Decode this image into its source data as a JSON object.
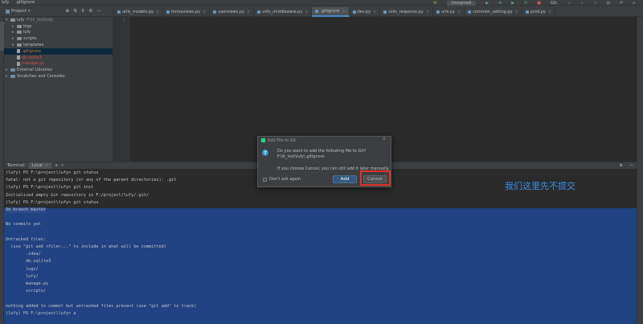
{
  "titlebar": {
    "project": "lufy",
    "file": ".gitignore",
    "run_config": "Unnamed",
    "git_label": "Git:"
  },
  "project_panel": {
    "title": "Project",
    "tree": [
      {
        "label": "lufy",
        "extra": "F:\\lk_test\\lufy",
        "depth": 0,
        "kind": "folder",
        "open": true
      },
      {
        "label": "logs",
        "depth": 1,
        "kind": "folder"
      },
      {
        "label": "lufy",
        "depth": 1,
        "kind": "folder"
      },
      {
        "label": "scripts",
        "depth": 1,
        "kind": "folder"
      },
      {
        "label": "templates",
        "depth": 1,
        "kind": "folder"
      },
      {
        "label": ".gitignore",
        "depth": 1,
        "kind": "file",
        "color": "#c77c2c",
        "selected": true
      },
      {
        "label": "db.sqlite3",
        "depth": 1,
        "kind": "file",
        "color": "#c75450"
      },
      {
        "label": "manage.py",
        "depth": 1,
        "kind": "file",
        "color": "#c75450"
      },
      {
        "label": "External Libraries",
        "depth": 0,
        "kind": "lib"
      },
      {
        "label": "Scratches and Consoles",
        "depth": 0,
        "kind": "lib"
      }
    ]
  },
  "tabs": [
    {
      "label": "utils_models.py"
    },
    {
      "label": "homeviews.py"
    },
    {
      "label": "userviews.py"
    },
    {
      "label": "utils_middleware.py"
    },
    {
      "label": ".gitignore",
      "active": true
    },
    {
      "label": "dev.py"
    },
    {
      "label": "utils_response.py"
    },
    {
      "label": "urls.py"
    },
    {
      "label": "common_setting.py"
    },
    {
      "label": "prod.py"
    }
  ],
  "editor": {
    "line_number": "1"
  },
  "terminal": {
    "tabs": [
      {
        "label": "Terminal:"
      },
      {
        "label": "Local"
      }
    ],
    "lines": [
      "(lufy) PS F:\\project\\lufy> git status",
      "fatal: not a git repository (or any of the parent directories): .git",
      "(lufy) PS F:\\project\\lufy> git init",
      "Initialized empty Git repository in F:/project/lufy/.git/",
      "(lufy) PS F:\\project\\lufy> git status",
      "On branch master",
      "",
      "No commits yet",
      "",
      "Untracked files:",
      "  (use \"git add <file>...\" to include in what will be committed)",
      "        .idea/",
      "        db.sqlite3",
      "        logs/",
      "        lufy/",
      "        manage.py",
      "        scripts/",
      "",
      "nothing added to commit but untracked files present (use \"git add\" to track)",
      "(lufy) PS F:\\project\\lufy> a"
    ]
  },
  "dialog": {
    "title": "Add File to Git",
    "question": "Do you want to add the following file to Git?",
    "path": "F:\\lk_test\\lufy\\.gitignore",
    "note": "If you choose Cancel, you can still add it later manually.",
    "checkbox_label": "Don't ask again",
    "add_label": "Add",
    "cancel_label": "Cancel"
  },
  "annotation": "我们这里先不提交",
  "colors": {
    "accent": "#4a88c7",
    "highlight_box": "#e0302c",
    "annotation": "#3a8fe6"
  }
}
